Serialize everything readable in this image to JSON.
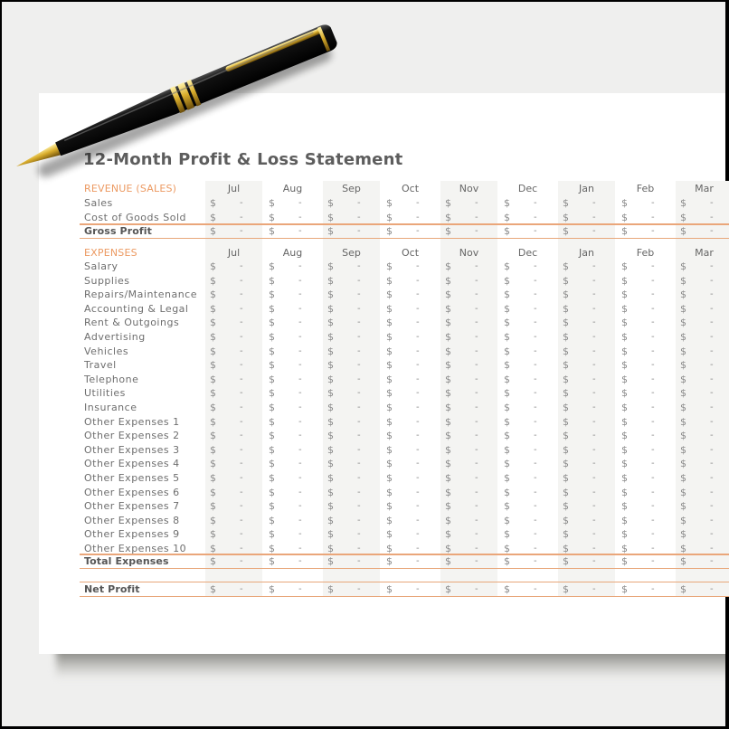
{
  "document": {
    "title": "12-Month Profit & Loss Statement",
    "accent_color": "#ec9a62",
    "line_color": "#e8a77a",
    "months": [
      "Jul",
      "Aug",
      "Sep",
      "Oct",
      "Nov",
      "Dec",
      "Jan",
      "Feb",
      "Mar"
    ],
    "currency_symbol": "$",
    "empty_value": "-",
    "revenue": {
      "header": "REVENUE (SALES)",
      "rows": [
        "Sales",
        "Cost of Goods Sold"
      ],
      "total_label": "Gross Profit"
    },
    "expenses": {
      "header": "EXPENSES",
      "rows": [
        "Salary",
        "Supplies",
        "Repairs/Maintenance",
        "Accounting & Legal",
        "Rent & Outgoings",
        "Advertising",
        "Vehicles",
        "Travel",
        "Telephone",
        "Utilities",
        "Insurance",
        "Other Expenses 1",
        "Other Expenses 2",
        "Other Expenses 3",
        "Other Expenses 4",
        "Other Expenses 5",
        "Other Expenses 6",
        "Other Expenses 7",
        "Other Expenses 8",
        "Other Expenses 9",
        "Other Expenses 10"
      ],
      "total_label": "Total Expenses"
    },
    "net_profit_label": "Net Profit"
  },
  "decor": {
    "pen": "ballpoint-pen-icon"
  }
}
